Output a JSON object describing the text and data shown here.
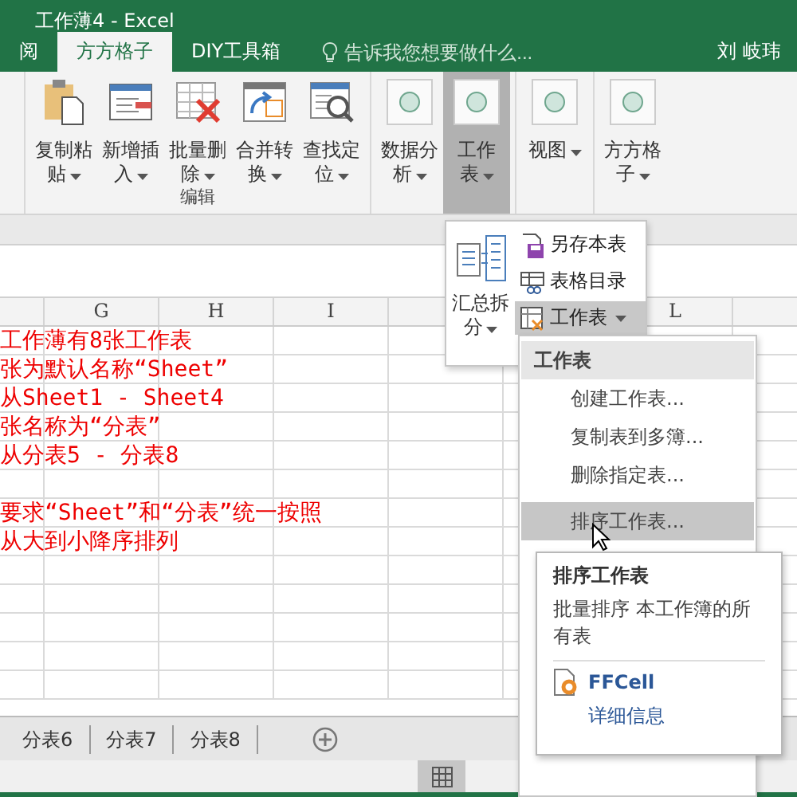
{
  "window": {
    "title": "工作薄4 - Excel"
  },
  "ribbon_tabs": [
    {
      "label": "阅",
      "selected": false
    },
    {
      "label": "方方格子",
      "selected": true
    },
    {
      "label": "DIY工具箱",
      "selected": false
    }
  ],
  "tell_me": {
    "placeholder": "告诉我您想要做什么..."
  },
  "user": "刘 岐玮",
  "ribbon_groups": [
    {
      "label": "编辑",
      "buttons": [
        {
          "kind": "paste",
          "lines": [
            "复制粘",
            "贴"
          ],
          "pressed": false
        },
        {
          "kind": "insert",
          "lines": [
            "新增插",
            "入"
          ],
          "pressed": false
        },
        {
          "kind": "delete",
          "lines": [
            "批量删",
            "除"
          ],
          "pressed": false
        },
        {
          "kind": "convert",
          "lines": [
            "合并转",
            "换"
          ],
          "pressed": false
        },
        {
          "kind": "find",
          "lines": [
            "查找定",
            "位"
          ],
          "pressed": false
        }
      ]
    },
    {
      "buttons": [
        {
          "kind": "circle",
          "lines": [
            "数据分",
            "析"
          ],
          "pressed": false
        },
        {
          "kind": "circle",
          "lines": [
            "工作",
            "表"
          ],
          "pressed": true
        }
      ]
    },
    {
      "buttons": [
        {
          "kind": "circle",
          "lines": [
            "视图"
          ],
          "pressed": false
        }
      ]
    },
    {
      "buttons": [
        {
          "kind": "circle",
          "lines": [
            "方方格",
            "子"
          ],
          "pressed": false
        }
      ]
    }
  ],
  "columns": [
    {
      "label": "G"
    },
    {
      "label": "H"
    },
    {
      "label": "I"
    },
    {
      "label": "L"
    }
  ],
  "notes": [
    [
      "工作薄有8张工作表",
      "张为默认名称“Sheet”",
      "从Sheet1 - Sheet4",
      "张名称为“分表”",
      "从分表5 - 分表8"
    ],
    [
      "要求“Sheet”和“分表”统一按照",
      "从大到小降序排列"
    ]
  ],
  "sheet_tabs": [
    {
      "label": "分表6",
      "selected": false
    },
    {
      "label": "分表7",
      "selected": false
    },
    {
      "label": "分表8",
      "selected": false
    }
  ],
  "dropdown": {
    "big_button": {
      "lines": [
        "汇总拆",
        "分"
      ]
    },
    "items": [
      {
        "kind": "save",
        "label": "另存本表",
        "selected": false
      },
      {
        "kind": "toc",
        "label": "表格目录",
        "selected": false
      },
      {
        "kind": "sheet",
        "label": "工作表",
        "selected": true
      }
    ]
  },
  "submenu": {
    "header": "工作表",
    "items": [
      {
        "label": "创建工作表...",
        "selected": false
      },
      {
        "label": "复制表到多簿...",
        "selected": false
      },
      {
        "label": "删除指定表...",
        "selected": false
      },
      {
        "label": "排序工作表...",
        "selected": true
      }
    ]
  },
  "tooltip": {
    "title": "排序工作表",
    "description": "批量排序 本工作簿的所有表",
    "addin": "FFCell",
    "link": "详细信息"
  },
  "view_buttons": [
    {
      "kind": "normal",
      "selected": true
    }
  ]
}
